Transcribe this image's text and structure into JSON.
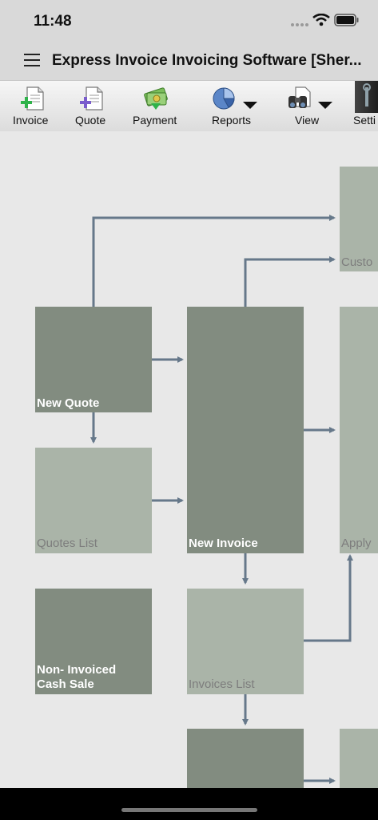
{
  "status": {
    "time": "11:48"
  },
  "header": {
    "title": "Express Invoice Invoicing Software [Sher..."
  },
  "toolbar": {
    "invoice": "Invoice",
    "quote": "Quote",
    "payment": "Payment",
    "reports": "Reports",
    "view": "View",
    "settings": "Setti"
  },
  "flow": {
    "new_quote": "New Quote",
    "quotes_list": "Quotes List",
    "new_invoice": "New Invoice",
    "non_invoiced_line1": "Non- Invoiced",
    "non_invoiced_line2": "Cash Sale",
    "invoices_list": "Invoices List",
    "customers": "Custo",
    "apply": "Apply"
  },
  "colors": {
    "dark_box": "#828c80",
    "light_box": "#aab4a8",
    "arrow": "#66788a",
    "canvas": "#e8e8e8"
  }
}
